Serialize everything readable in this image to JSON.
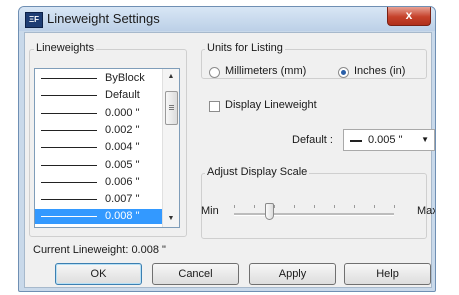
{
  "window": {
    "title": "Lineweight Settings",
    "icon": "autocad-app-icon",
    "close_label": "x"
  },
  "lineweights": {
    "group_label": "Lineweights",
    "items": [
      {
        "label": "ByBlock",
        "selected": false
      },
      {
        "label": "Default",
        "selected": false
      },
      {
        "label": "0.000 \"",
        "selected": false
      },
      {
        "label": "0.002 \"",
        "selected": false
      },
      {
        "label": "0.004 \"",
        "selected": false
      },
      {
        "label": "0.005 \"",
        "selected": false
      },
      {
        "label": "0.006 \"",
        "selected": false
      },
      {
        "label": "0.007 \"",
        "selected": false
      },
      {
        "label": "0.008 \"",
        "selected": true
      }
    ]
  },
  "units": {
    "group_label": "Units for Listing",
    "options": [
      {
        "label": "Millimeters (mm)",
        "checked": false
      },
      {
        "label": "Inches (in)",
        "checked": true
      }
    ]
  },
  "display_lineweight": {
    "label": "Display Lineweight",
    "checked": false
  },
  "default": {
    "label": "Default :",
    "value": "0.005 \""
  },
  "scale": {
    "group_label": "Adjust Display Scale",
    "min_label": "Min",
    "max_label": "Max",
    "level": 0.22
  },
  "current": {
    "text": "Current Lineweight:  0.008 \""
  },
  "buttons": {
    "ok": "OK",
    "cancel": "Cancel",
    "apply": "Apply",
    "help": "Help"
  },
  "colors": {
    "selection": "#3399ff",
    "title_bar": "#c9d9ea",
    "close": "#c5412a"
  }
}
